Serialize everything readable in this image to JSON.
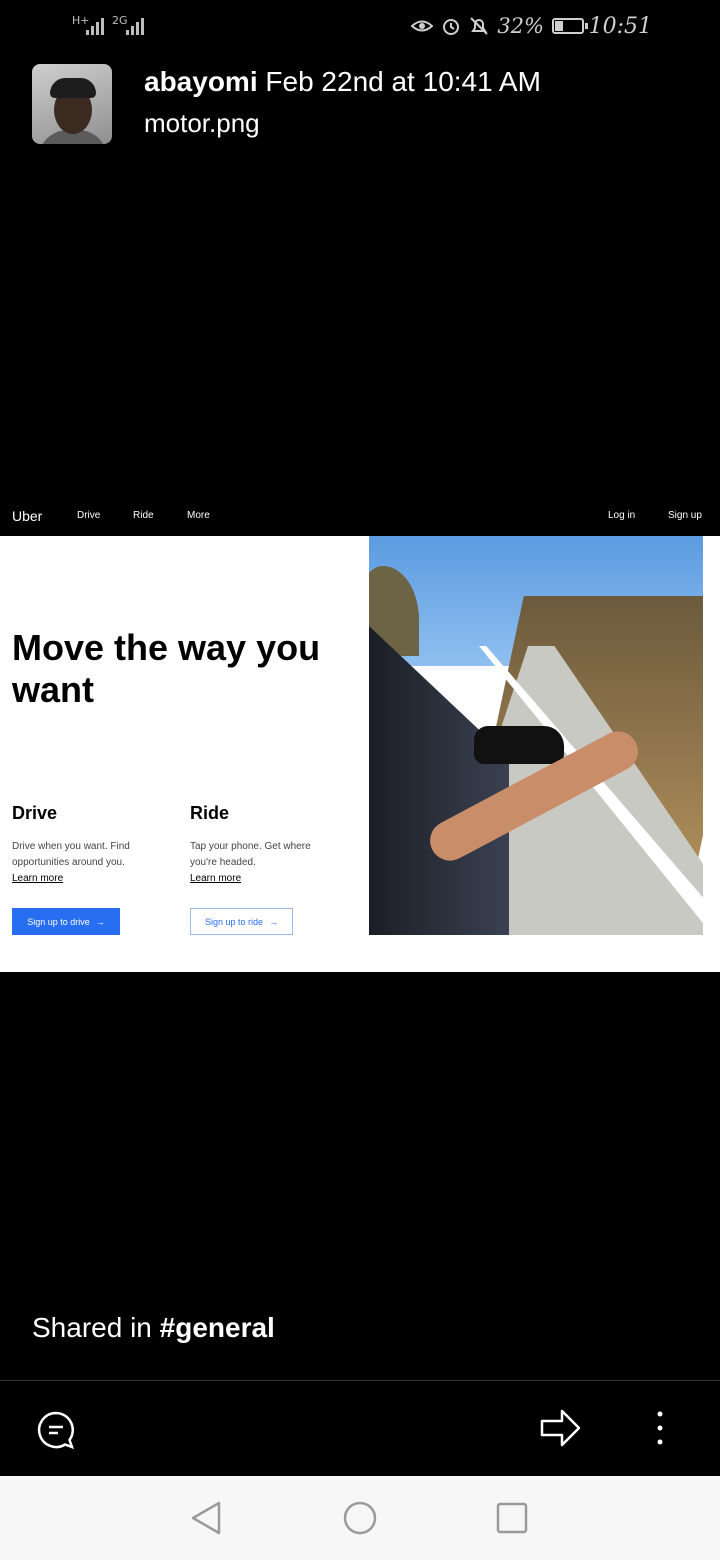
{
  "status_bar": {
    "sim1_label": "H+",
    "sim2_label": "2G",
    "battery_percent": "32%",
    "battery_level": 0.32,
    "time": "10:51"
  },
  "message": {
    "sender": "abayomi",
    "timestamp": "Feb 22nd at 10:41 AM",
    "filename": "motor.png"
  },
  "screenshot": {
    "nav": {
      "logo": "Uber",
      "items": [
        "Drive",
        "Ride",
        "More"
      ],
      "login": "Log in",
      "signup": "Sign up"
    },
    "hero_title": "Move the way you want",
    "drive": {
      "heading": "Drive",
      "body": "Drive when you want. Find opportunities around you.",
      "link": "Learn more",
      "button": "Sign up to drive"
    },
    "ride": {
      "heading": "Ride",
      "body": "Tap your phone. Get where you're headed.",
      "link": "Learn more",
      "button": "Sign up to ride"
    },
    "accent_color": "#276ef1"
  },
  "shared": {
    "prefix": "Shared in",
    "channel": "#general"
  },
  "actions": {
    "comment_icon": "comment-icon",
    "share_icon": "share-icon",
    "more_icon": "more-icon"
  },
  "android_nav": [
    "back-icon",
    "home-icon",
    "recents-icon"
  ]
}
